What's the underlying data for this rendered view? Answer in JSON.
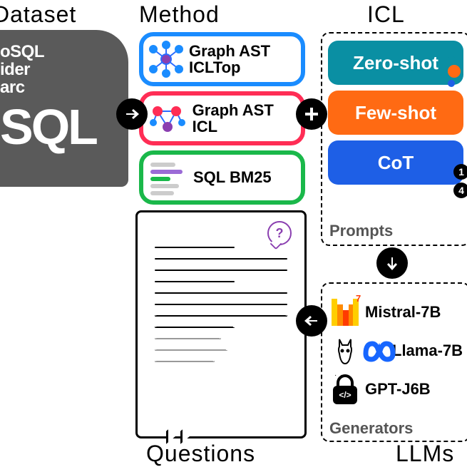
{
  "headers": {
    "dataset": "Dataset",
    "method": "Method",
    "icl": "ICL",
    "questions": "Questions",
    "llms": "LLMs"
  },
  "dataset": {
    "lines": [
      "oSQL",
      "ider",
      "arc"
    ],
    "big": "SQL"
  },
  "method": {
    "cards": [
      {
        "text": "Graph AST ICLTop"
      },
      {
        "text": "Graph AST ICL"
      },
      {
        "text": "SQL BM25"
      }
    ]
  },
  "icl": {
    "prompts": [
      {
        "label": "Zero-shot"
      },
      {
        "label": "Few-shot"
      },
      {
        "label": "CoT"
      }
    ],
    "caption": "Prompts",
    "numbers": [
      "1",
      "4"
    ]
  },
  "generators": {
    "items": [
      {
        "label": "Mistral-7B",
        "badge": "7"
      },
      {
        "label": "Llama-7B"
      },
      {
        "label": "GPT-J6B"
      }
    ],
    "caption": "Generators"
  },
  "question_bubble": "?"
}
